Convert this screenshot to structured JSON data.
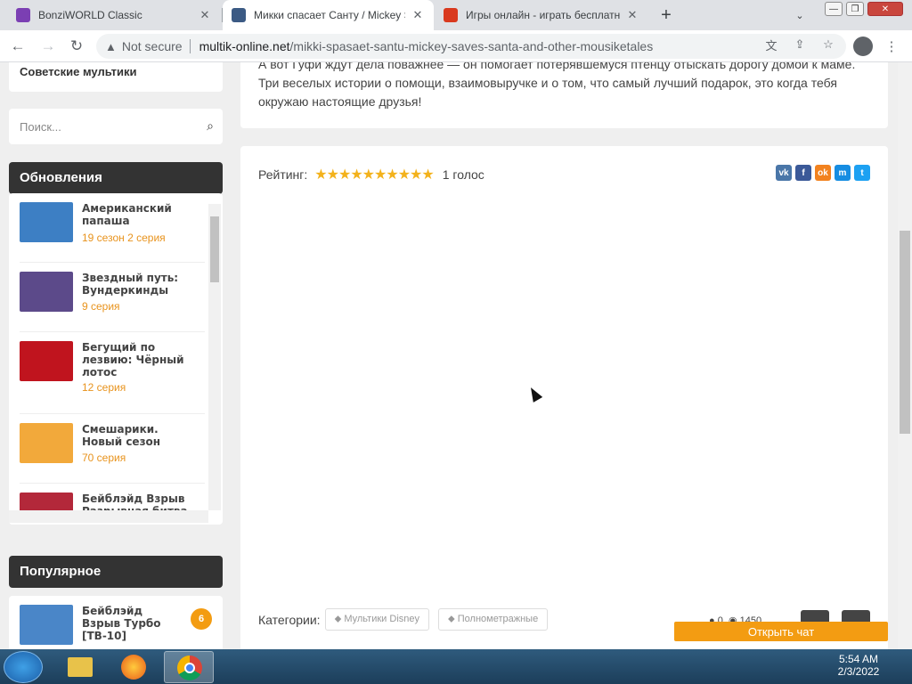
{
  "browser": {
    "tabs": [
      {
        "title": "BonziWORLD Classic",
        "close": "✕"
      },
      {
        "title": "Микки спасает Санту / Mickey S",
        "close": "✕"
      },
      {
        "title": "Игры онлайн - играть бесплатн",
        "close": "✕"
      }
    ],
    "new_tab": "+",
    "security": "Not secure",
    "url_host": "multik-online.net",
    "url_path": "/mikki-spasaet-santu-mickey-saves-santa-and-other-mousiketales"
  },
  "sidebar": {
    "soviet_label": "Советские мультики",
    "search_placeholder": "Поиск...",
    "updates_title": "Обновления",
    "updates": [
      {
        "name": "Американский папаша",
        "episode": "19 сезон 2 серия",
        "thumb_color": "#3d7fc4"
      },
      {
        "name": "Звездный путь: Вундеркинды",
        "episode": "9 серия",
        "thumb_color": "#5c4a8a"
      },
      {
        "name": "Бегущий по лезвию: Чёрный лотос",
        "episode": "12 серия",
        "thumb_color": "#c0141e"
      },
      {
        "name": "Смешарики. Новый сезон",
        "episode": "70 серия",
        "thumb_color": "#f2a93b"
      },
      {
        "name": "Бейблэйд Взрыв Разрывная битва",
        "episode": "",
        "thumb_color": "#b3283a"
      }
    ],
    "popular_title": "Популярное",
    "popular": [
      {
        "name": "Бейблэйд Взрыв Турбо [ТВ-10]",
        "badge": "6",
        "thumb_color": "#4a86c8"
      }
    ]
  },
  "content": {
    "description": "А вот Гуфи ждут дела поважнее — он помогает потерявшемуся птенцу отыскать дорогу домой к маме. Три веселых истории о помощи, взаимовыручке и о том, что самый лучший подарок, это когда тебя окружаю настоящие друзья!",
    "rating_label": "Рейтинг:",
    "rating_stars": "★★★★★★★★★★",
    "votes": "1 голос",
    "social": [
      {
        "label": "vk",
        "color": "#4a76a8"
      },
      {
        "label": "f",
        "color": "#3b5998"
      },
      {
        "label": "ok",
        "color": "#f2821f"
      },
      {
        "label": "m",
        "color": "#168de2"
      },
      {
        "label": "t",
        "color": "#1da1f2"
      }
    ],
    "categories_label": "Категории:",
    "categories": [
      "Мультики Disney",
      "Полнометражные"
    ],
    "comments": "0",
    "views": "1450",
    "chat_button": "Открыть чат"
  },
  "taskbar": {
    "time": "5:54 AM",
    "date": "2/3/2022"
  }
}
